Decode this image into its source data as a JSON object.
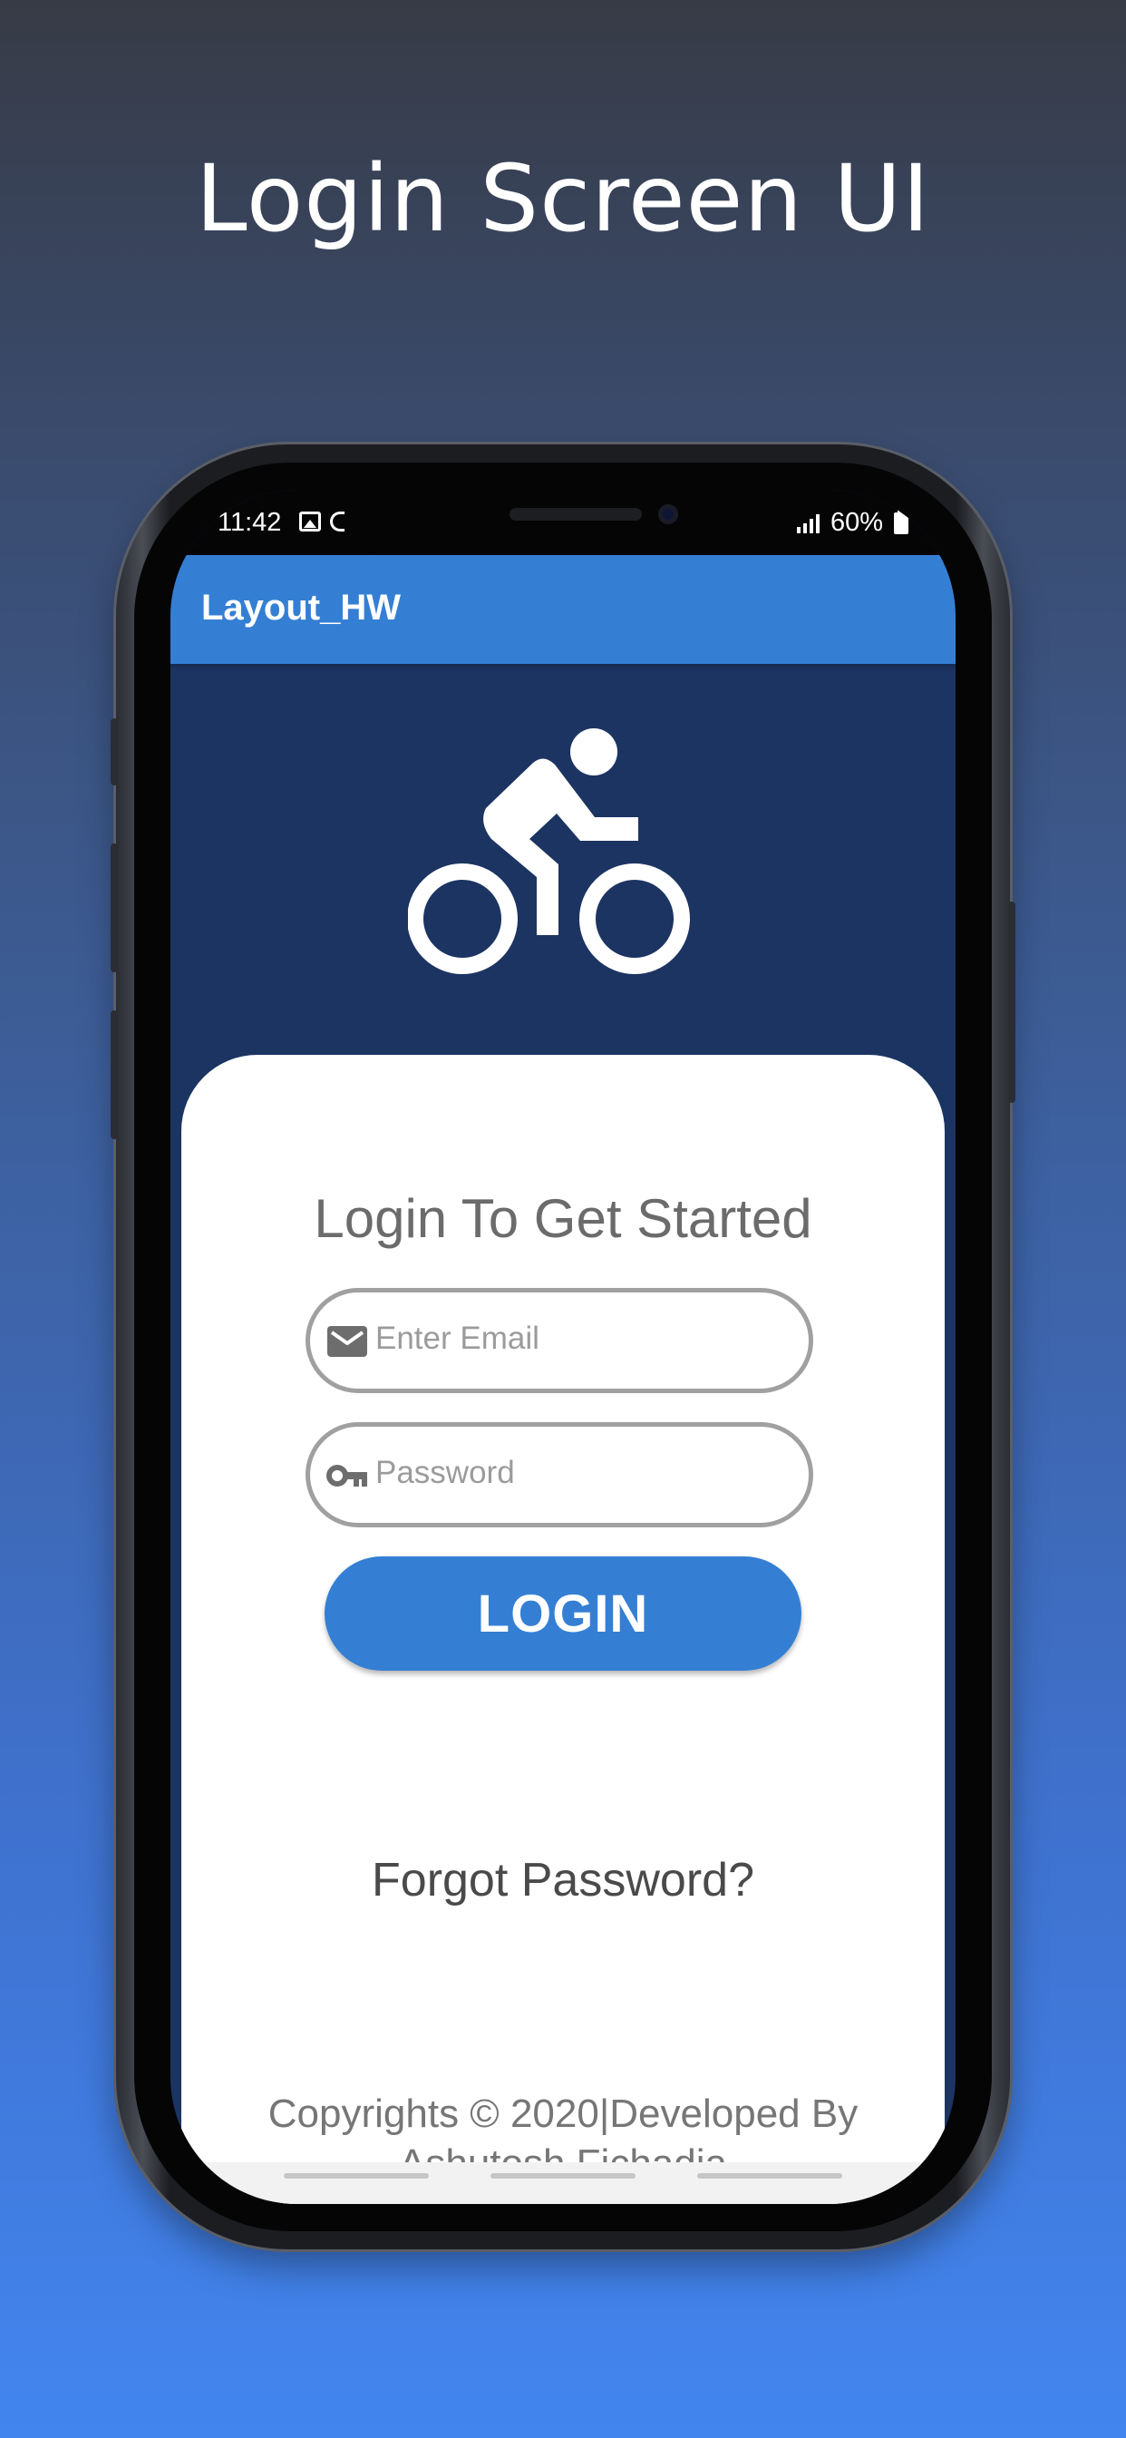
{
  "page": {
    "headline": "Login Screen UI"
  },
  "status_bar": {
    "time": "11:42",
    "battery": "60%",
    "icons": [
      "image-icon",
      "c-icon",
      "signal-icon",
      "battery-icon"
    ]
  },
  "app_bar": {
    "title": "Layout_HW"
  },
  "hero": {
    "icon": "cyclist-icon"
  },
  "login_card": {
    "title": "Login To Get Started",
    "email": {
      "placeholder": "Enter Email",
      "value": "",
      "icon": "mail-icon"
    },
    "password": {
      "placeholder": "Password",
      "value": "",
      "icon": "key-icon"
    },
    "login_label": "LOGIN",
    "forgot_label": "Forgot Password?",
    "copyright_line1": "Copyrights © 2020|Developed By",
    "copyright_line2": "Ashutosh Fichadia"
  },
  "colors": {
    "accent": "#347fd4",
    "hero_background": "#1c3462",
    "card": "#ffffff"
  }
}
